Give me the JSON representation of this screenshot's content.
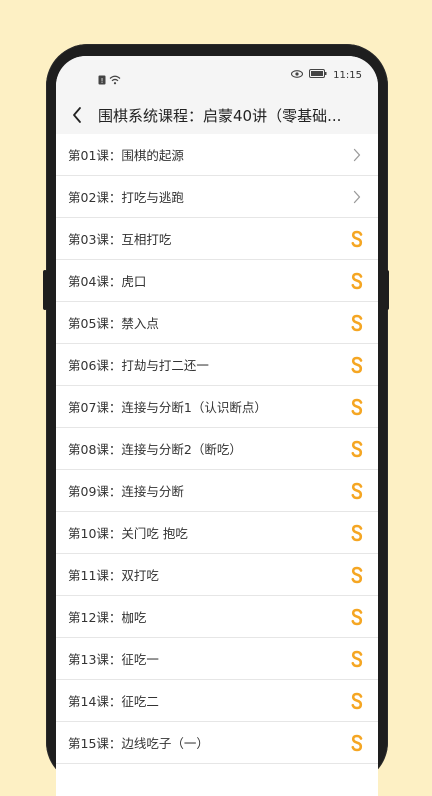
{
  "status": {
    "time": "11:15"
  },
  "header": {
    "title": "围棋系统课程：启蒙40讲（零基础..."
  },
  "lessons": [
    {
      "label": "第01课：围棋的起源",
      "icon": "chevron-right-icon"
    },
    {
      "label": "第02课：打吃与逃跑",
      "icon": "chevron-right-icon"
    },
    {
      "label": "第03课：互相打吃",
      "icon": "coin-icon"
    },
    {
      "label": "第04课：虎口",
      "icon": "coin-icon"
    },
    {
      "label": "第05课：禁入点",
      "icon": "coin-icon"
    },
    {
      "label": "第06课：打劫与打二还一",
      "icon": "coin-icon"
    },
    {
      "label": "第07课：连接与分断1（认识断点）",
      "icon": "coin-icon"
    },
    {
      "label": "第08课：连接与分断2（断吃）",
      "icon": "coin-icon"
    },
    {
      "label": "第09课：连接与分断",
      "icon": "coin-icon"
    },
    {
      "label": "第10课：关门吃 抱吃",
      "icon": "coin-icon"
    },
    {
      "label": "第11课：双打吃",
      "icon": "coin-icon"
    },
    {
      "label": "第12课：枷吃",
      "icon": "coin-icon"
    },
    {
      "label": "第13课：征吃一",
      "icon": "coin-icon"
    },
    {
      "label": "第14课：征吃二",
      "icon": "coin-icon"
    },
    {
      "label": "第15课：边线吃子（一）",
      "icon": "coin-icon"
    }
  ],
  "colors": {
    "background": "#fdf0c4",
    "coin": "#f5a623",
    "header": "#f5f5f5"
  }
}
